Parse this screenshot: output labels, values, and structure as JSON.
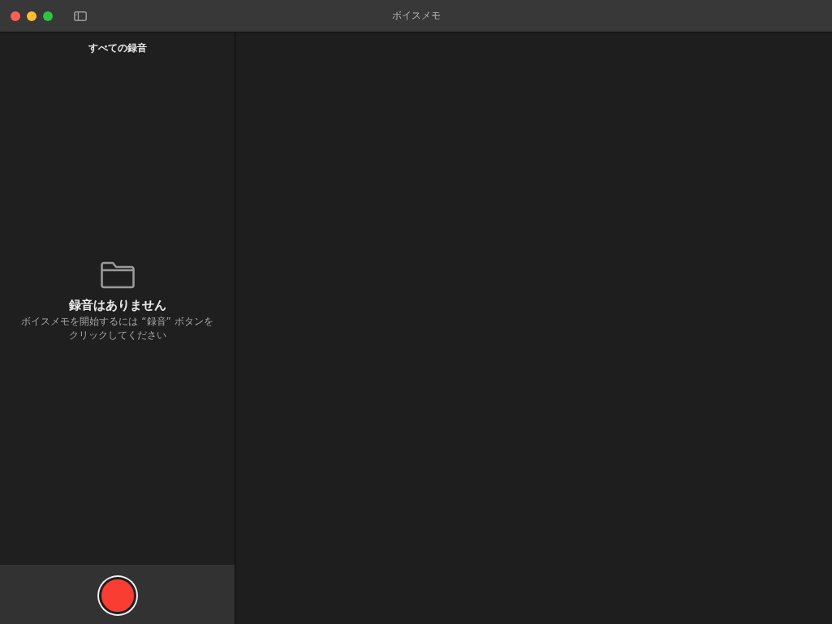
{
  "window": {
    "title": "ボイスメモ"
  },
  "sidebar": {
    "header": "すべての録音",
    "empty_state": {
      "title": "録音はありません",
      "message": "ボイスメモを開始するには “録音” ボタンをクリックしてください"
    }
  }
}
